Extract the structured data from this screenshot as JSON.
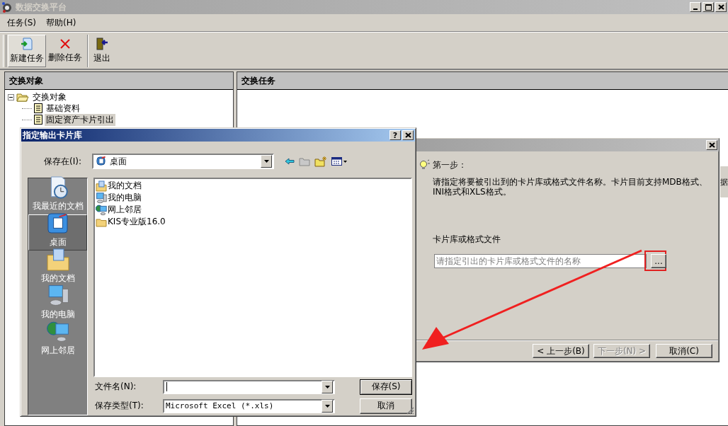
{
  "window": {
    "title": "数据交换平台"
  },
  "menu": [
    {
      "label": "任务(S)"
    },
    {
      "label": "帮助(H)"
    }
  ],
  "toolbar": [
    {
      "label": "新建任务",
      "kind": "new",
      "selected": true
    },
    {
      "label": "删除任务",
      "kind": "delete",
      "selected": false
    },
    {
      "label": "退出",
      "kind": "exit",
      "selected": false
    }
  ],
  "left_panel": {
    "title": "交换对象",
    "tree": [
      {
        "label": "交换对象",
        "expanded": true,
        "children": [
          {
            "label": "基础资料",
            "selected": false
          },
          {
            "label": "固定资产卡片引出",
            "selected": true
          }
        ]
      }
    ]
  },
  "right_panel": {
    "title": "交换任务",
    "columns": [
      "据"
    ]
  },
  "wizard": {
    "step_title": "第一步：",
    "description": "请指定将要被引出到的卡片库或格式文件名称。卡片目前支持MDB格式、INI格式和XLS格式。",
    "field_label": "卡片库或格式文件",
    "field_placeholder": "请指定引出的卡片库或格式文件的名称",
    "browse_label": "...",
    "buttons": [
      {
        "label": "< 上一步(B)",
        "disabled": false
      },
      {
        "label": "下一步(N) >",
        "disabled": true
      },
      {
        "label": "取消(C)",
        "disabled": false
      }
    ]
  },
  "save_dialog": {
    "title": "指定输出卡片库",
    "help_label": "?",
    "save_in_label": "保存在(I):",
    "save_in_value": "桌面",
    "places": [
      {
        "label": "我最近的文档",
        "kind": "recent",
        "selected": false
      },
      {
        "label": "桌面",
        "kind": "desktop",
        "selected": true
      },
      {
        "label": "我的文档",
        "kind": "documents",
        "selected": false
      },
      {
        "label": "我的电脑",
        "kind": "computer",
        "selected": false
      },
      {
        "label": "网上邻居",
        "kind": "network",
        "selected": false
      }
    ],
    "files": [
      {
        "name": "我的文档",
        "kind": "documents"
      },
      {
        "name": "我的电脑",
        "kind": "computer"
      },
      {
        "name": "网上邻居",
        "kind": "network"
      },
      {
        "name": "KIS专业版16.0",
        "kind": "folder"
      }
    ],
    "filename_label": "文件名(N):",
    "filetype_label": "保存类型(T):",
    "filetype_value": "Microsoft Excel (*.xls)",
    "buttons": [
      {
        "label": "保存(S)",
        "default": true
      },
      {
        "label": "取消",
        "default": false
      }
    ]
  }
}
